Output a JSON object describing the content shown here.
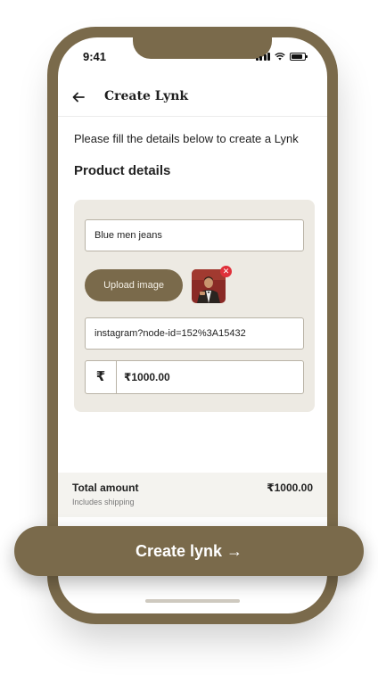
{
  "status": {
    "time": "9:41"
  },
  "header": {
    "title": "Create Lynk"
  },
  "intro": "Please fill the details below to create a Lynk",
  "section_title": "Product details",
  "form": {
    "product_name": "Blue men jeans",
    "upload_label": "Upload image",
    "link_value": "instagram?node-id=152%3A15432",
    "currency_symbol": "₹",
    "price_value": "₹1000.00"
  },
  "total": {
    "label": "Total amount",
    "sub": "Includes shipping",
    "value": "₹1000.00"
  },
  "cta": {
    "label": "Create lynk →"
  },
  "colors": {
    "brand": "#7a6a4b",
    "card_bg": "#edeae3",
    "danger": "#e0303a"
  }
}
